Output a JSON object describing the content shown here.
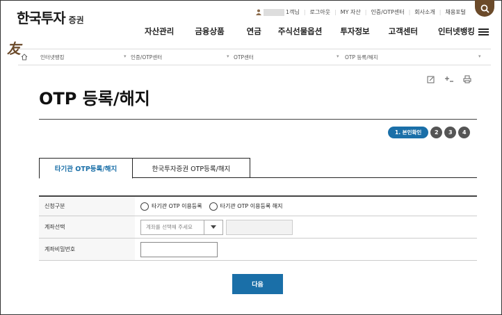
{
  "header": {
    "logo_main": "한국투자",
    "logo_sub": "증권",
    "logo_mark": "友",
    "util": {
      "user_suffix": "1객님",
      "links": [
        "로그아웃",
        "MY 자산",
        "인증/OTP센터",
        "회사소개",
        "채용포털"
      ]
    },
    "search_icon": "search-icon",
    "nav": [
      "자산관리",
      "금융상품",
      "연금",
      "주식선물옵션",
      "투자정보",
      "고객센터",
      "인터넷뱅킹"
    ],
    "menu_icon": "hamburger-icon"
  },
  "breadcrumb": [
    "인터넷뱅킹",
    "인증/OTP센터",
    "OTP센터",
    "OTP 등록/해지"
  ],
  "page_title": "OTP 등록/해지",
  "steps": {
    "active": "1. 본인확인",
    "others": [
      "2",
      "3",
      "4"
    ]
  },
  "tabs": [
    "타기관 OTP등록/해지",
    "한국투자증권 OTP등록/해지"
  ],
  "form": {
    "rows": [
      {
        "label": "신청구분",
        "options": [
          "타기관 OTP 이용등록",
          "타기관 OTP 이용등록 해지"
        ]
      },
      {
        "label": "계좌선택",
        "placeholder": "계좌를 선택해 주세요"
      },
      {
        "label": "계좌비밀번호"
      }
    ]
  },
  "next_button": "다음",
  "colors": {
    "accent": "#1a6fa8",
    "brand": "#6b4a2a"
  }
}
